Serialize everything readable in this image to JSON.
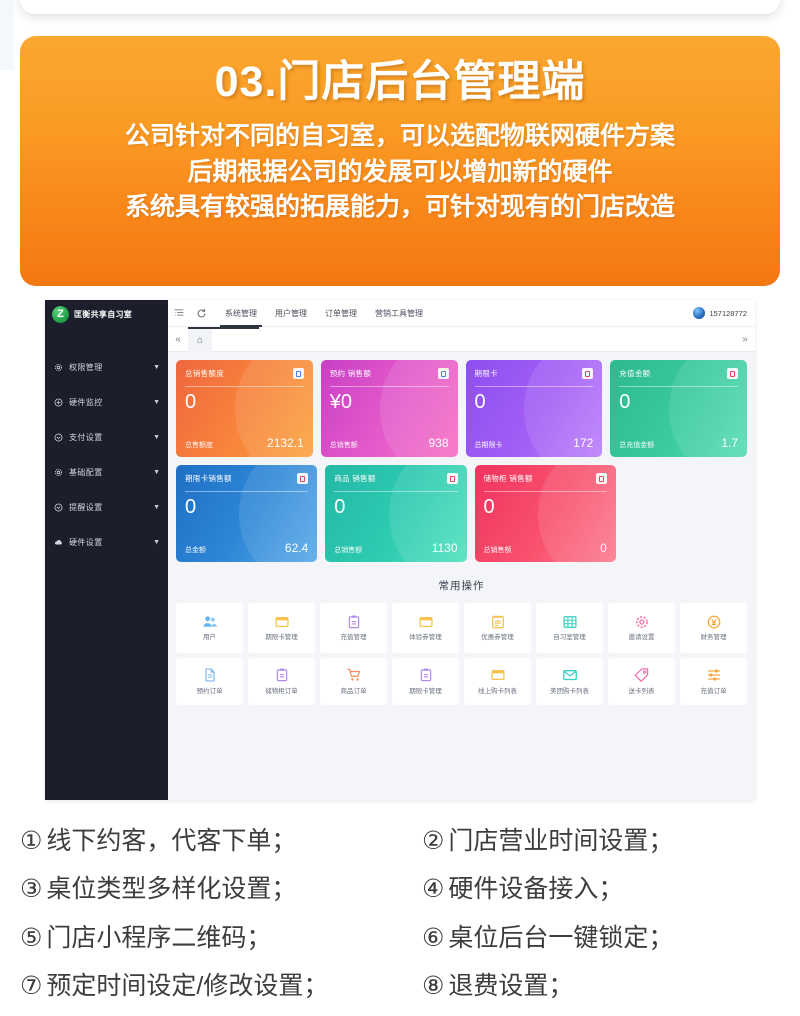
{
  "banner": {
    "title": "03.门店后台管理端",
    "lines": [
      "公司针对不同的自习室，可以选配物联网硬件方案",
      "后期根据公司的发展可以增加新的硬件",
      "系统具有较强的拓展能力，可针对现有的门店改造"
    ],
    "gradient_from": "#fba730",
    "gradient_to": "#f47810"
  },
  "app": {
    "brand": {
      "logo_glyph": "Z",
      "name": "匡衡共享自习室"
    },
    "sidebar": [
      {
        "label": "权限管理",
        "icon": "gear-icon"
      },
      {
        "label": "硬件监控",
        "icon": "target-icon"
      },
      {
        "label": "支付设置",
        "icon": "target-icon"
      },
      {
        "label": "基础配置",
        "icon": "gear-icon"
      },
      {
        "label": "提醒设置",
        "icon": "target-icon"
      },
      {
        "label": "硬件设置",
        "icon": "cloud-icon"
      }
    ],
    "topbar": {
      "menu_icon": "list-menu-icon",
      "refresh_icon": "refresh-icon",
      "tabs": [
        {
          "label": "系统管理",
          "active": true
        },
        {
          "label": "用户管理",
          "active": false
        },
        {
          "label": "订单管理",
          "active": false
        },
        {
          "label": "营销工具管理",
          "active": false
        }
      ],
      "account": "157128772"
    },
    "crumbbar": {
      "collapse_icon": "«",
      "home_icon": "⌂",
      "expand_icon": "»"
    },
    "stat_cards_row1": [
      {
        "title": "总销售额度",
        "value": "0",
        "foot_label": "总售额度",
        "foot_value": "2132.1",
        "color": "c-orange",
        "badge": "badge-blue"
      },
      {
        "title": "预约 销售额",
        "value": "¥0",
        "foot_label": "总销售额",
        "foot_value": "938",
        "color": "c-pink",
        "badge": "badge-blue"
      },
      {
        "title": "期限卡",
        "value": "0",
        "foot_label": "总期限卡",
        "foot_value": "172",
        "color": "c-purple",
        "badge": "badge-red"
      },
      {
        "title": "充值金额",
        "value": "0",
        "foot_label": "总充值金额",
        "foot_value": "1.7",
        "color": "c-green",
        "badge": "badge-red"
      }
    ],
    "stat_cards_row2": [
      {
        "title": "期限卡销售额",
        "value": "0",
        "foot_label": "总金额",
        "foot_value": "62.4",
        "color": "c-blue",
        "badge": "badge-red"
      },
      {
        "title": "商品 销售额",
        "value": "0",
        "foot_label": "总销售额",
        "foot_value": "1130",
        "color": "c-teal",
        "badge": "badge-red"
      },
      {
        "title": "储物柜 销售额",
        "value": "0",
        "foot_label": "总销售额",
        "foot_value": "0",
        "color": "c-red",
        "badge": "badge-red"
      }
    ],
    "ops_title": "常用操作",
    "ops_row1": [
      {
        "label": "用户",
        "icon": "users-icon",
        "color": "#64b5f6"
      },
      {
        "label": "期限卡管理",
        "icon": "card-window-icon",
        "color": "#f6c34b"
      },
      {
        "label": "充值管理",
        "icon": "clipboard-icon",
        "color": "#b08ae8"
      },
      {
        "label": "体验券管理",
        "icon": "card-window-icon",
        "color": "#f6c34b"
      },
      {
        "label": "优惠券管理",
        "icon": "coupon-clipboard-icon",
        "color": "#f3c14a"
      },
      {
        "label": "自习室管理",
        "icon": "grid-icon",
        "color": "#34cfc0"
      },
      {
        "label": "邀请设置",
        "icon": "gear-icon",
        "color": "#f870a8"
      },
      {
        "label": "财务管理",
        "icon": "yen-circle-icon",
        "color": "#f5a93c"
      }
    ],
    "ops_row2": [
      {
        "label": "预约订单",
        "icon": "document-icon",
        "color": "#7fb7f0"
      },
      {
        "label": "储物柜订单",
        "icon": "clipboard-icon",
        "color": "#b08ae8"
      },
      {
        "label": "商品订单",
        "icon": "cart-icon",
        "color": "#f78b5d"
      },
      {
        "label": "期限卡管理",
        "icon": "clipboard-icon",
        "color": "#b08ae8"
      },
      {
        "label": "线上购卡列表",
        "icon": "card-window-icon",
        "color": "#f6c34b"
      },
      {
        "label": "美团购卡列表",
        "icon": "mail-icon",
        "color": "#34cfc0"
      },
      {
        "label": "送卡列表",
        "icon": "tag-icon",
        "color": "#f870a8"
      },
      {
        "label": "充值订单",
        "icon": "sliders-icon",
        "color": "#f5a93c"
      }
    ]
  },
  "bullets": [
    {
      "num": "①",
      "text": "线下约客，代客下单；"
    },
    {
      "num": "②",
      "text": "门店营业时间设置；"
    },
    {
      "num": "③",
      "text": "桌位类型多样化设置；"
    },
    {
      "num": "④",
      "text": "硬件设备接入；"
    },
    {
      "num": "⑤",
      "text": "门店小程序二维码；"
    },
    {
      "num": "⑥",
      "text": "桌位后台一键锁定；"
    },
    {
      "num": "⑦",
      "text": "预定时间设定/修改设置；"
    },
    {
      "num": "⑧",
      "text": "退费设置；"
    }
  ]
}
